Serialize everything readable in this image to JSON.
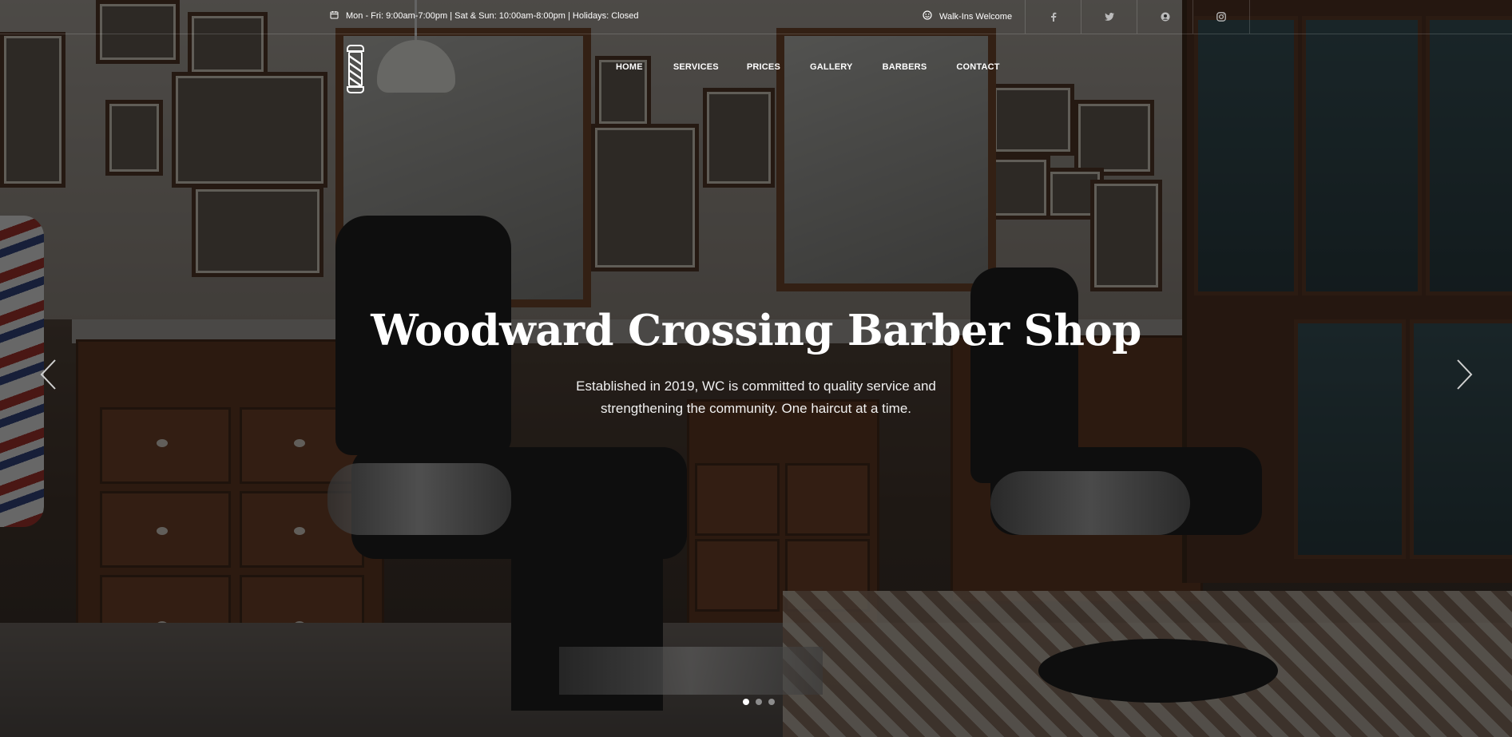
{
  "topbar": {
    "hours": "Mon - Fri: 9:00am-7:00pm | Sat & Sun: 10:00am-8:00pm | Holidays: Closed",
    "hours_icon": "calendar-icon",
    "walkins": "Walk-Ins Welcome",
    "walkins_icon": "smile-icon",
    "social": [
      {
        "name": "facebook-icon",
        "glyph": "f"
      },
      {
        "name": "twitter-icon",
        "glyph": "t"
      },
      {
        "name": "yelp-icon",
        "glyph": "y"
      },
      {
        "name": "instagram-icon",
        "glyph": "i"
      }
    ]
  },
  "logo": {
    "icon": "barber-pole-icon"
  },
  "nav": {
    "items": [
      {
        "label": "HOME"
      },
      {
        "label": "SERVICES"
      },
      {
        "label": "PRICES"
      },
      {
        "label": "GALLERY"
      },
      {
        "label": "BARBERS"
      },
      {
        "label": "CONTACT"
      }
    ]
  },
  "hero": {
    "title": "Woodward Crossing Barber Shop",
    "subtitle_line1": "Established in 2019, WC is committed to quality service and",
    "subtitle_line2": "strengthening the community. One haircut at a time."
  },
  "slider": {
    "prev_icon": "chevron-left-icon",
    "next_icon": "chevron-right-icon",
    "slide_count": 3,
    "active_slide": 1
  }
}
